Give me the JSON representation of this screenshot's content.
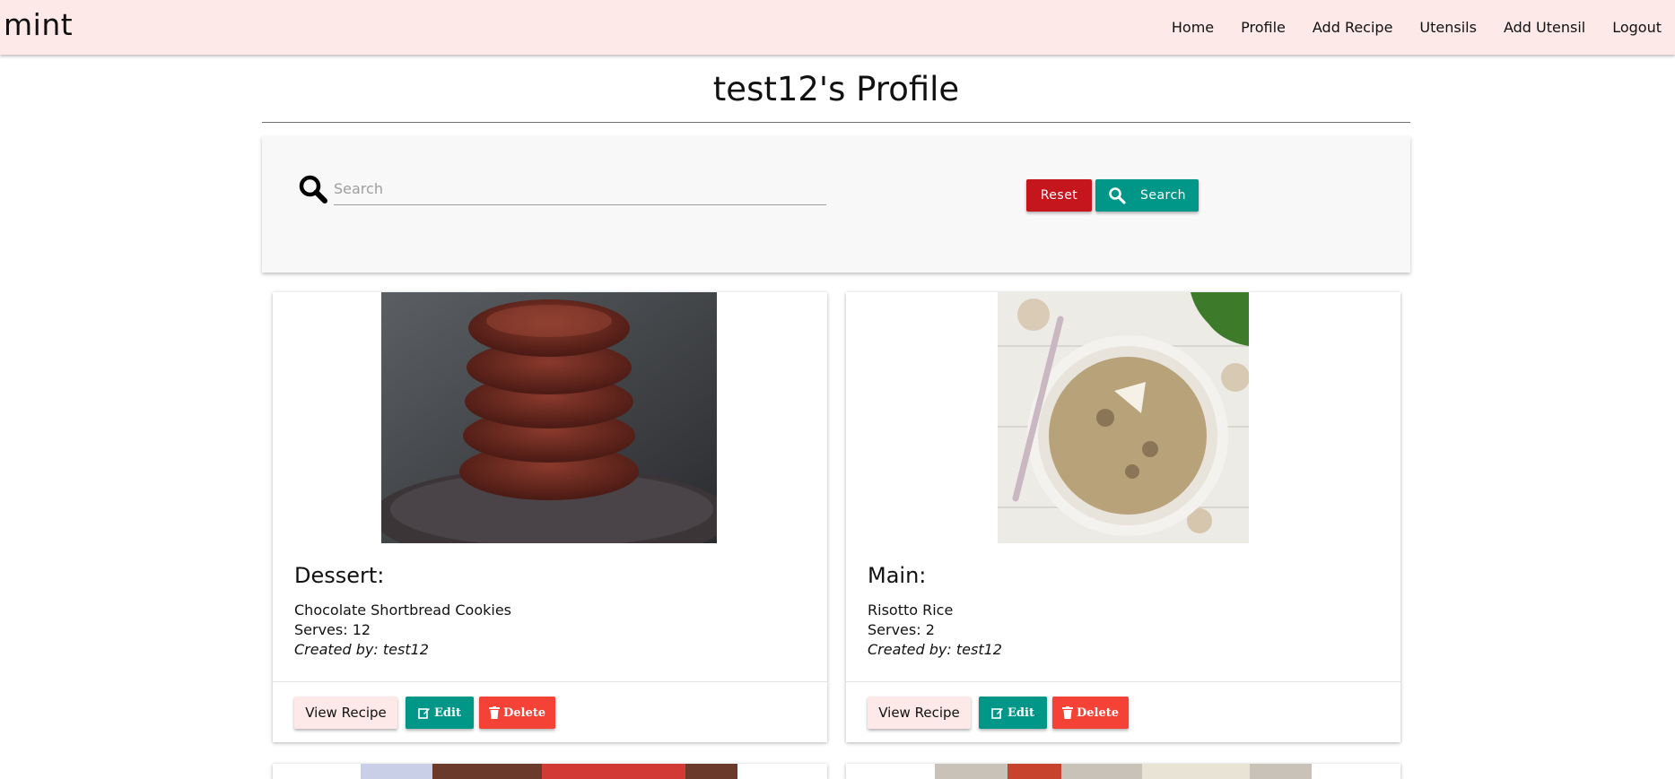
{
  "brand": "mint",
  "nav": [
    {
      "label": "Home"
    },
    {
      "label": "Profile"
    },
    {
      "label": "Add Recipe"
    },
    {
      "label": "Utensils"
    },
    {
      "label": "Add Utensil"
    },
    {
      "label": "Logout"
    }
  ],
  "page_title": "test12's Profile",
  "search": {
    "placeholder": "Search",
    "value": "",
    "reset_label": "Reset",
    "search_label": "Search"
  },
  "colors": {
    "navbar": "#fde9e7",
    "reset": "#c6161d",
    "teal": "#009688",
    "delete": "#f44336"
  },
  "recipes": [
    {
      "category": "Dessert:",
      "name": "Chocolate Shortbread Cookies",
      "serves": "Serves: 12",
      "author": "Created by: test12",
      "image": "chocolate-cookies-stack-image",
      "view_label": "View Recipe",
      "edit_label": "Edit",
      "delete_label": "Delete"
    },
    {
      "category": "Main:",
      "name": "Risotto Rice",
      "serves": "Serves: 2",
      "author": "Created by: test12",
      "image": "mushroom-risotto-bowl-image",
      "view_label": "View Recipe",
      "edit_label": "Edit",
      "delete_label": "Delete"
    }
  ]
}
